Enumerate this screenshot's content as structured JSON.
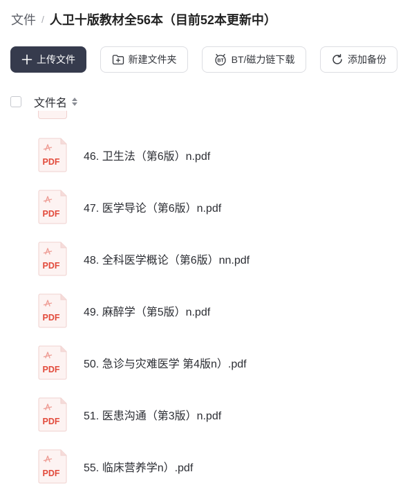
{
  "breadcrumb": {
    "root": "文件",
    "separator": "/",
    "current": "人卫十版教材全56本（目前52本更新中）"
  },
  "toolbar": {
    "upload": "上传文件",
    "new_folder": "新建文件夹",
    "bt_magnet": "BT/磁力链下载",
    "add_backup": "添加备份"
  },
  "list_header": {
    "name_column": "文件名"
  },
  "files": [
    {
      "name": "46. 卫生法（第6版）n.pdf",
      "icon_label": "PDF"
    },
    {
      "name": "47. 医学导论（第6版）n.pdf",
      "icon_label": "PDF"
    },
    {
      "name": "48. 全科医学概论（第6版）nn.pdf",
      "icon_label": "PDF"
    },
    {
      "name": "49. 麻醉学（第5版）n.pdf",
      "icon_label": "PDF"
    },
    {
      "name": "50. 急诊与灾难医学 第4版n）.pdf",
      "icon_label": "PDF"
    },
    {
      "name": "51. 医患沟通（第3版）n.pdf",
      "icon_label": "PDF"
    },
    {
      "name": "55. 临床营养学n）.pdf",
      "icon_label": "PDF"
    }
  ],
  "colors": {
    "primary_button": "#363b4d",
    "pdf_red": "#e24a3b",
    "pdf_bg": "#fdf3f2"
  }
}
